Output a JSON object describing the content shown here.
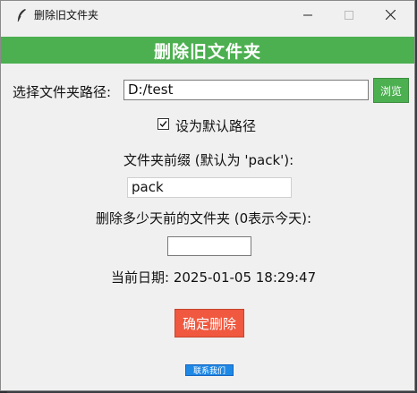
{
  "window": {
    "title": "删除旧文件夹",
    "minimize_icon": "minimize-icon",
    "maximize_icon": "maximize-icon",
    "close_icon": "close-icon"
  },
  "header": {
    "banner": "删除旧文件夹",
    "banner_color": "#4caf50"
  },
  "path": {
    "label": "选择文件夹路径:",
    "value": "D:/test",
    "browse_label": "浏览"
  },
  "default_path": {
    "label": "设为默认路径",
    "checked": true
  },
  "prefix": {
    "label": "文件夹前缀 (默认为 'pack'):",
    "value": "pack"
  },
  "days": {
    "label": "删除多少天前的文件夹 (0表示今天):",
    "value": ""
  },
  "date": {
    "text": "当前日期: 2025-01-05 18:29:47"
  },
  "actions": {
    "delete_label": "确定删除",
    "delete_color": "#f0583f",
    "contact_label": "联系我们",
    "contact_color": "#1e88e5"
  }
}
